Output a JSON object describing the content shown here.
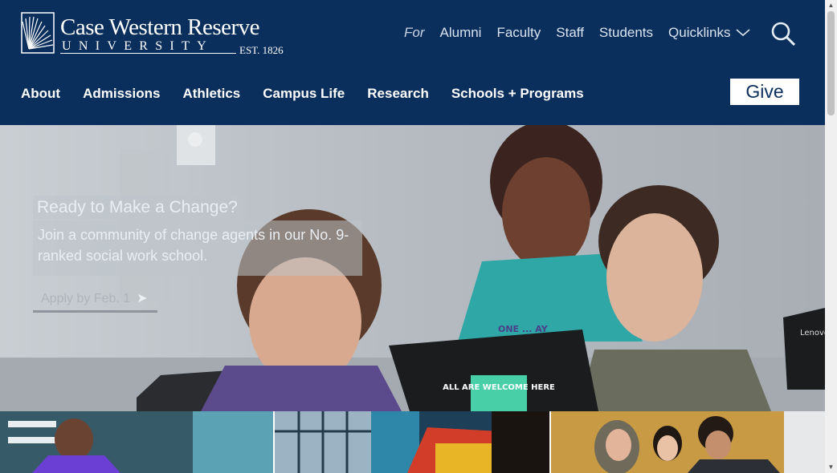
{
  "logo": {
    "name": "Case Western Reserve",
    "sub": "UNIVERSITY",
    "est": "EST. 1826"
  },
  "audience": {
    "for_label": "For",
    "links": [
      "Alumni",
      "Faculty",
      "Staff",
      "Students"
    ],
    "quicklinks_label": "Quicklinks"
  },
  "nav": {
    "items": [
      "About",
      "Admissions",
      "Athletics",
      "Campus Life",
      "Research",
      "Schools + Programs"
    ],
    "give_label": "Give"
  },
  "hero": {
    "title": "Ready to Make a Change?",
    "body": "Join a community of change agents in our No. 9-ranked social work school.",
    "cta_label": "Apply by Feb. 1",
    "cta_arrow": "➤",
    "laptop_sticker": "ALL ARE WELCOME HERE",
    "laptop_brand": "Lenovo",
    "shirt_text": "ONE ... AY"
  },
  "icons": {
    "search": "search-icon",
    "chevron": "chevron-down-icon",
    "logo_mark": "sunburst-logo-icon"
  },
  "colors": {
    "header_bg": "#0a2f5c",
    "give_text": "#0a2f5c"
  }
}
